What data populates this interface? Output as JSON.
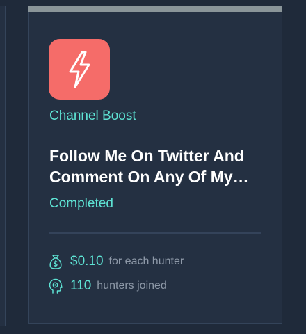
{
  "card": {
    "icon": "lightning-bolt-icon",
    "icon_bg_color": "#f56c69",
    "category": "Channel Boost",
    "title": "Follow Me On Twitter And Comment On Any Of My…",
    "status": "Completed",
    "reward": {
      "icon": "money-bag-icon",
      "value": "$0.10",
      "label": "for each hunter"
    },
    "hunters": {
      "icon": "head-icon",
      "value": "110",
      "label": "hunters joined"
    }
  },
  "colors": {
    "background": "#1f2a3a",
    "card": "#243042",
    "accent": "#5ee3d4",
    "muted": "#8e99a8",
    "top_bar": "#8a9599"
  }
}
